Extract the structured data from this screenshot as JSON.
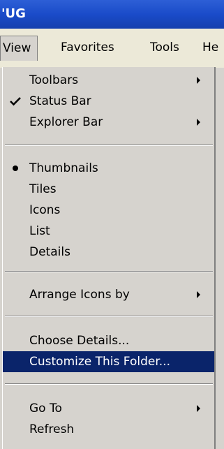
{
  "window": {
    "title": "'UG"
  },
  "menubar": {
    "items": [
      {
        "label": "View",
        "active": true
      },
      {
        "label": "Favorites"
      },
      {
        "label": "Tools"
      },
      {
        "label": "He"
      }
    ]
  },
  "view_menu": {
    "items": [
      {
        "label": "Toolbars",
        "submenu": true
      },
      {
        "label": "Status Bar",
        "checked": true
      },
      {
        "label": "Explorer Bar",
        "submenu": true
      },
      {
        "label": "Thumbnails",
        "selected_option": true
      },
      {
        "label": "Tiles"
      },
      {
        "label": "Icons"
      },
      {
        "label": "List"
      },
      {
        "label": "Details"
      },
      {
        "label": "Arrange Icons by",
        "submenu": true
      },
      {
        "label": "Choose Details..."
      },
      {
        "label": "Customize This Folder...",
        "highlighted": true
      },
      {
        "label": "Go To",
        "submenu": true
      },
      {
        "label": "Refresh"
      }
    ]
  },
  "colors": {
    "title_bar": "#1a4bc9",
    "menu_background": "#d6d3ce",
    "highlight": "#0a246a",
    "highlight_text": "#ffffff"
  }
}
